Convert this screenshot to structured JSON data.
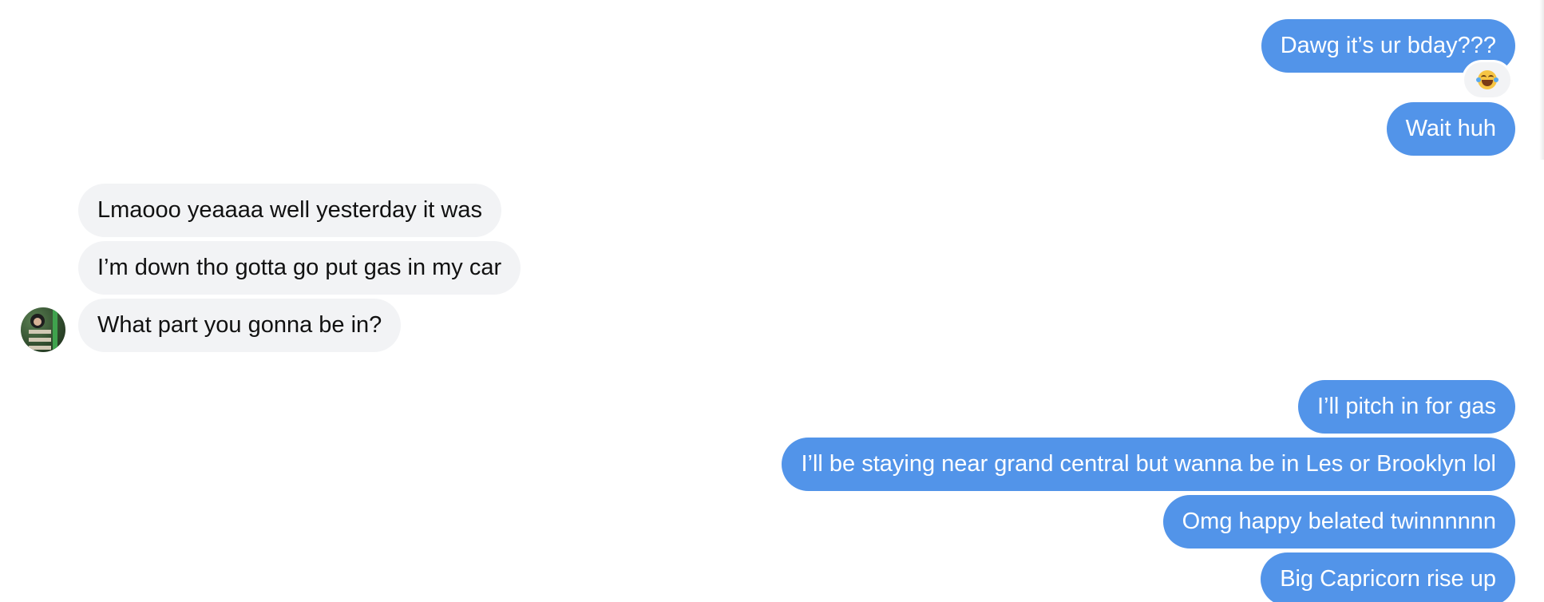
{
  "messages": [
    {
      "id": "m1",
      "direction": "sent",
      "text": "Dawg it’s ur bday???"
    },
    {
      "id": "m2",
      "direction": "sent",
      "text": "Wait huh"
    },
    {
      "id": "m3",
      "direction": "received",
      "text": "Lmaooo yeaaaa well yesterday it was"
    },
    {
      "id": "m4",
      "direction": "received",
      "text": "I’m down tho gotta go put gas in my car"
    },
    {
      "id": "m5",
      "direction": "received",
      "text": "What part you gonna be in?"
    },
    {
      "id": "m6",
      "direction": "sent",
      "text": "I’ll pitch in for gas"
    },
    {
      "id": "m7",
      "direction": "sent",
      "text": "I’ll be staying near grand central but wanna be in Les or Brooklyn lol"
    },
    {
      "id": "m8",
      "direction": "sent",
      "text": "Omg happy belated twinnnnnn"
    },
    {
      "id": "m9",
      "direction": "sent",
      "text": "Big Capricorn rise up"
    }
  ],
  "reaction": {
    "on_message": "m1",
    "icon": "laughing-tears-emoji-icon"
  },
  "avatar": {
    "icon": "contact-avatar"
  },
  "colors": {
    "sent_bubble": "#5294e9",
    "received_bubble": "#f2f3f5",
    "sent_text": "#ffffff",
    "received_text": "#111111"
  }
}
